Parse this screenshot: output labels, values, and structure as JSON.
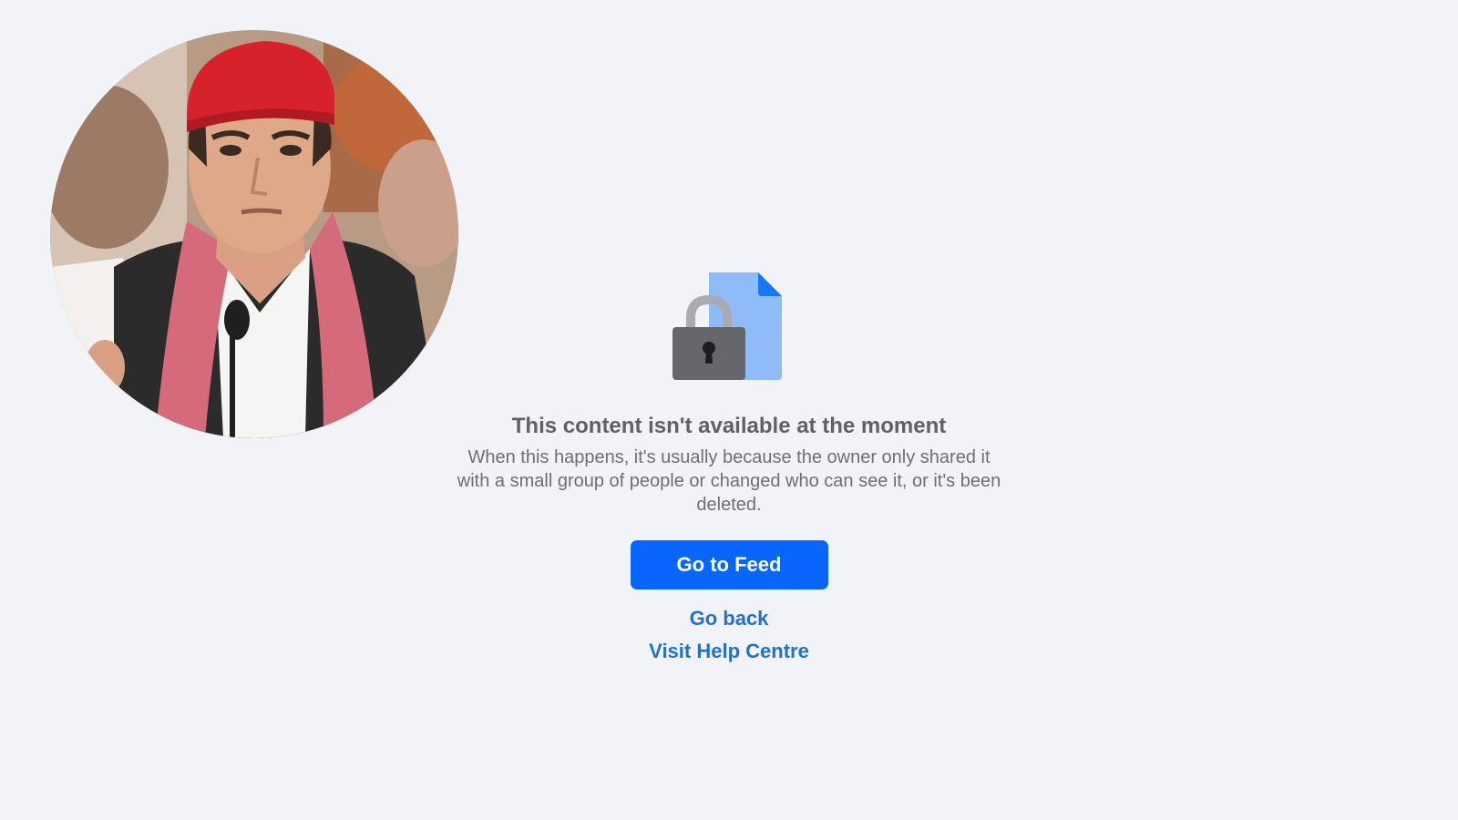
{
  "profile": {
    "avatar_description": "profile photo"
  },
  "message": {
    "illustration_icon": "locked-document-icon",
    "title": "This content isn't available at the moment",
    "description": "When this happens, it's usually because the owner only shared it with a small group of people or changed who can see it, or it's been deleted."
  },
  "actions": {
    "primary_label": "Go to Feed",
    "back_label": "Go back",
    "help_label": "Visit Help Centre"
  },
  "colors": {
    "page_background": "#f1f3f7",
    "primary_button": "#0866ff",
    "link": "#2372c9",
    "title_text": "#5f6166",
    "body_text": "#6d6f73",
    "document_blue": "#8fbcf7",
    "document_fold": "#1877f2",
    "lock_body": "#65676b",
    "lock_shackle": "#a8acb2"
  }
}
